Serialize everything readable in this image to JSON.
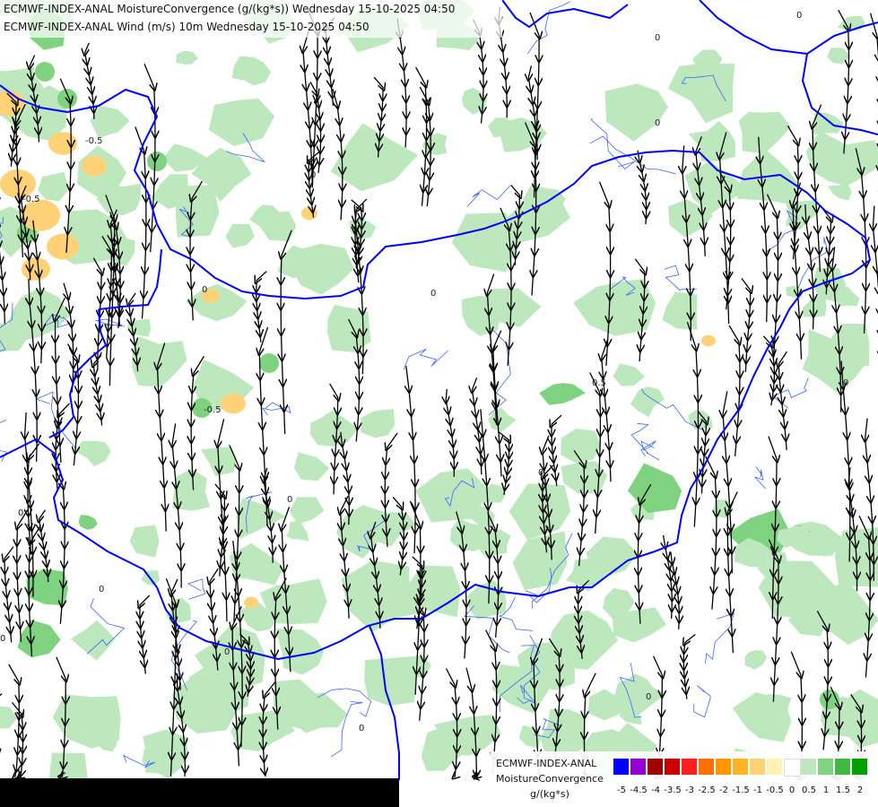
{
  "titles": [
    "ECMWF-INDEX-ANAL MoistureConvergence (g/(kg*s)) Wednesday 15-10-2025 04:50",
    "ECMWF-INDEX-ANAL Wind (m/s) 10m Wednesday 15-10-2025 04:50"
  ],
  "legend": {
    "model": "ECMWF-INDEX-ANAL",
    "parameter": "MoistureConvergence",
    "unit": "g/(kg*s)",
    "ticks": [
      "-5",
      "-4.5",
      "-4",
      "-3.5",
      "-3",
      "-2.5",
      "-2",
      "-1.5",
      "-1",
      "-0.5",
      "0",
      "0.5",
      "1",
      "1.5",
      "2"
    ],
    "colors": [
      "#0000ff",
      "#9400d3",
      "#a00000",
      "#c80000",
      "#ff1e1e",
      "#ff6e00",
      "#ff9600",
      "#ffb428",
      "#ffd278",
      "#fff0b4",
      "#ffffff",
      "#bde8bd",
      "#7fd27f",
      "#3fb93f",
      "#00a000"
    ]
  },
  "contour_labels": [
    "0",
    "0",
    "0",
    "-0.5",
    "-0.5",
    "-0.5",
    "0",
    "0.5",
    "0",
    "0",
    "0",
    "0",
    "0",
    "0",
    "0",
    "0",
    "0",
    "0",
    "0",
    "0"
  ],
  "colors": {
    "border": "#0000ff",
    "river": "#3c64ff",
    "streamline": "#000000",
    "light_green": "#bde8bd",
    "orange": "#ffd278"
  }
}
